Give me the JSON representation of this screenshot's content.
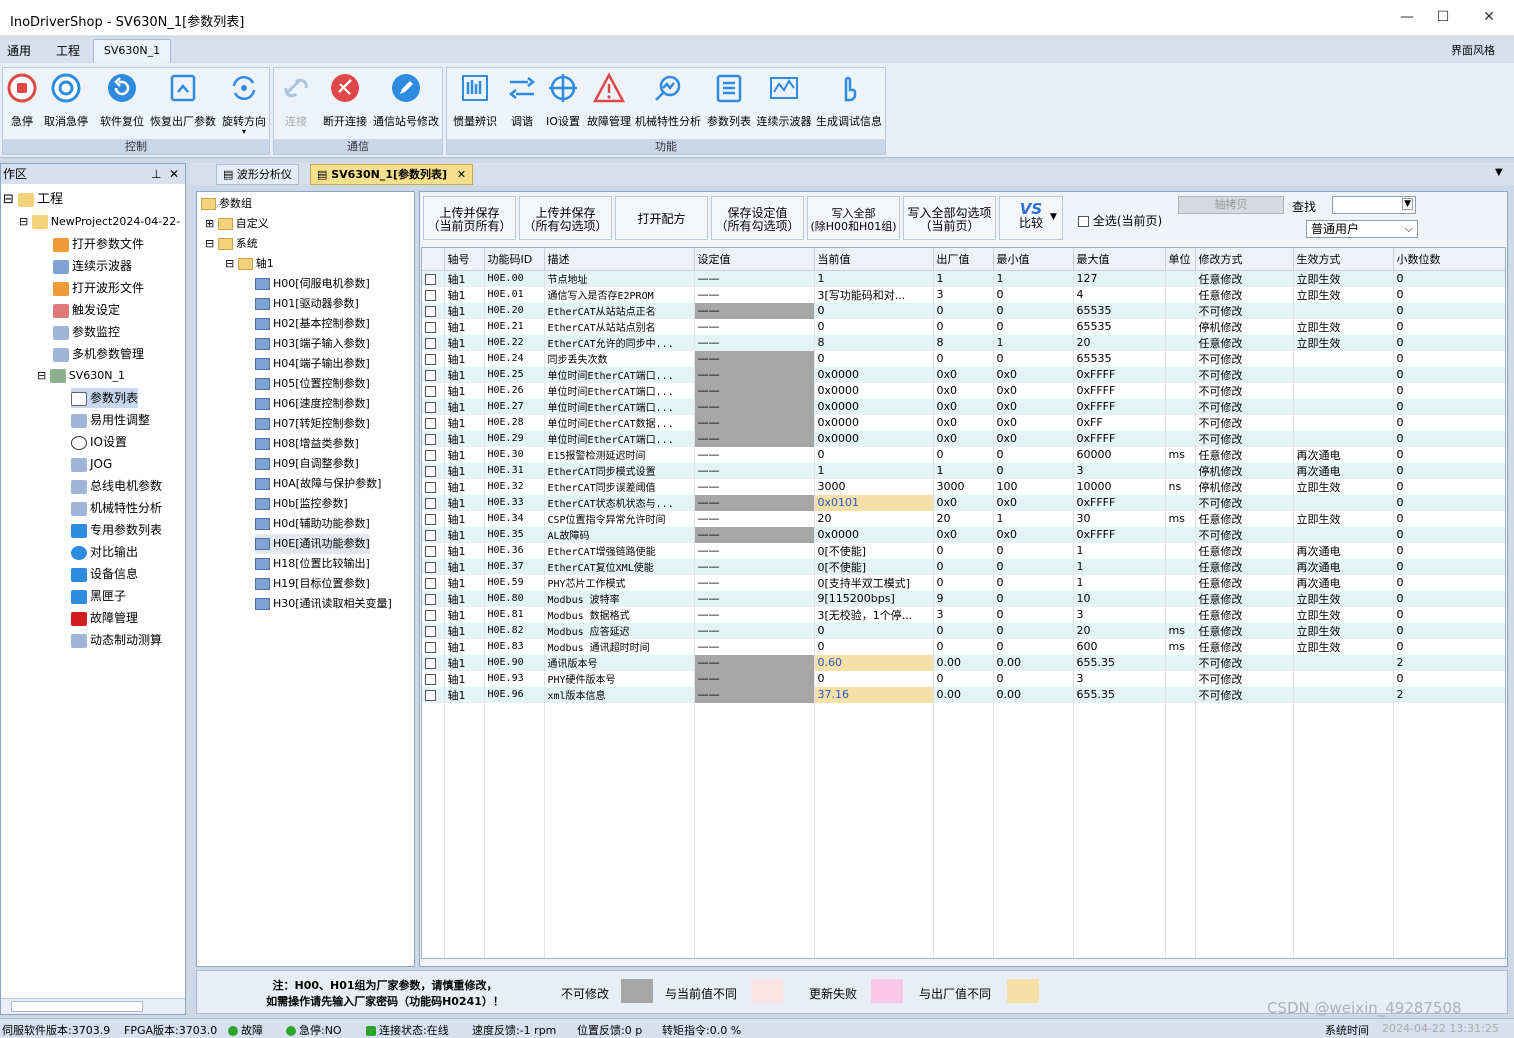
{
  "window": {
    "title": "InoDriverShop - SV630N_1[参数列表]",
    "minimize": "—",
    "maximize": "☐",
    "close": "✕"
  },
  "menu": {
    "items": [
      "通用",
      "工程"
    ],
    "active_tab": "SV630N_1",
    "right": "界面风格"
  },
  "ribbon": {
    "groups": [
      {
        "title": "控制"
      },
      {
        "title": "通信"
      },
      {
        "title": "功能"
      }
    ],
    "control": [
      "急停",
      "取消急停",
      "软件复位",
      "恢复出厂参数",
      "旋转方向"
    ],
    "comm": [
      "连接",
      "断开连接",
      "通信站号修改"
    ],
    "func": [
      "惯量辨识",
      "调谐",
      "IO设置",
      "故障管理",
      "机械特性分析",
      "参数列表",
      "连续示波器",
      "生成调试信息"
    ]
  },
  "left": {
    "header": "作区",
    "items": [
      "工程",
      "NewProject2024-04-22-",
      "打开参数文件",
      "连续示波器",
      "打开波形文件",
      "触发设定",
      "参数监控",
      "多机参数管理",
      "SV630N_1",
      "参数列表",
      "易用性调整",
      "IO设置",
      "JOG",
      "总线电机参数",
      "机械特性分析",
      "专用参数列表",
      "对比输出",
      "设备信息",
      "黑匣子",
      "故障管理",
      "动态制动测算"
    ]
  },
  "tabs": [
    "波形分析仪",
    "SV630N_1[参数列表]"
  ],
  "tree": {
    "root": "参数组",
    "custom": "自定义",
    "system": "系统",
    "axis": "轴1",
    "groups": [
      "H00[伺服电机参数]",
      "H01[驱动器参数]",
      "H02[基本控制参数]",
      "H03[端子输入参数]",
      "H04[端子输出参数]",
      "H05[位置控制参数]",
      "H06[速度控制参数]",
      "H07[转矩控制参数]",
      "H08[增益类参数]",
      "H09[自调整参数]",
      "H0A[故障与保护参数]",
      "H0b[监控参数]",
      "H0d[辅助功能参数]",
      "H0E[通讯功能参数]",
      "H18[位置比较输出]",
      "H19[目标位置参数]",
      "H30[通讯读取相关变量]"
    ]
  },
  "toolbar": {
    "b1a": "上传并保存",
    "b1b": "（当前页所有）",
    "b2a": "上传并保存",
    "b2b": "（所有勾选项）",
    "b3": "打开配方",
    "b4a": "保存设定值",
    "b4b": "（所有勾选项）",
    "b5a": "写入全部",
    "b5b": "(除H00和H01组)",
    "b6a": "写入全部勾选项",
    "b6b": "（当前页）",
    "vs": "VS",
    "compare": "比较",
    "selectall": "全选(当前页)",
    "copy": "轴拷贝",
    "search": "查找",
    "user": "普通用户"
  },
  "columns": [
    "",
    "轴号",
    "功能码ID",
    "描述",
    "设定值",
    "当前值",
    "出厂值",
    "最小值",
    "最大值",
    "单位",
    "修改方式",
    "生效方式",
    "小数位数"
  ],
  "rows": [
    [
      "轴1",
      "H0E.00",
      "节点地址",
      "——",
      "1",
      "1",
      "1",
      "127",
      "",
      "任意修改",
      "立即生效",
      "0",
      "",
      ""
    ],
    [
      "轴1",
      "H0E.01",
      "通信写入是否存E2PROM",
      "——",
      "3[写功能码和对...",
      "3",
      "0",
      "4",
      "",
      "任意修改",
      "立即生效",
      "0",
      "",
      ""
    ],
    [
      "轴1",
      "H0E.20",
      "EtherCAT从站站点正名",
      "——",
      "0",
      "0",
      "0",
      "65535",
      "",
      "不可修改",
      "",
      "0",
      "g",
      ""
    ],
    [
      "轴1",
      "H0E.21",
      "EtherCAT从站站点别名",
      "——",
      "0",
      "0",
      "0",
      "65535",
      "",
      "停机修改",
      "立即生效",
      "0",
      "",
      ""
    ],
    [
      "轴1",
      "H0E.22",
      "EtherCAT允许的同步中...",
      "——",
      "8",
      "8",
      "1",
      "20",
      "",
      "任意修改",
      "立即生效",
      "0",
      "",
      ""
    ],
    [
      "轴1",
      "H0E.24",
      "同步丢失次数",
      "——",
      "0",
      "0",
      "0",
      "65535",
      "",
      "不可修改",
      "",
      "0",
      "g",
      ""
    ],
    [
      "轴1",
      "H0E.25",
      "单位时间EtherCAT端口...",
      "——",
      "0x0000",
      "0x0",
      "0x0",
      "0xFFFF",
      "",
      "不可修改",
      "",
      "0",
      "g",
      ""
    ],
    [
      "轴1",
      "H0E.26",
      "单位时间EtherCAT端口...",
      "——",
      "0x0000",
      "0x0",
      "0x0",
      "0xFFFF",
      "",
      "不可修改",
      "",
      "0",
      "g",
      ""
    ],
    [
      "轴1",
      "H0E.27",
      "单位时间EtherCAT端口...",
      "——",
      "0x0000",
      "0x0",
      "0x0",
      "0xFFFF",
      "",
      "不可修改",
      "",
      "0",
      "g",
      ""
    ],
    [
      "轴1",
      "H0E.28",
      "单位时间EtherCAT数据...",
      "——",
      "0x0000",
      "0x0",
      "0x0",
      "0xFF",
      "",
      "不可修改",
      "",
      "0",
      "g",
      ""
    ],
    [
      "轴1",
      "H0E.29",
      "单位时间EtherCAT端口...",
      "——",
      "0x0000",
      "0x0",
      "0x0",
      "0xFFFF",
      "",
      "不可修改",
      "",
      "0",
      "g",
      ""
    ],
    [
      "轴1",
      "H0E.30",
      "E15报警检测延迟时间",
      "——",
      "0",
      "0",
      "0",
      "60000",
      "ms",
      "任意修改",
      "再次通电",
      "0",
      "",
      ""
    ],
    [
      "轴1",
      "H0E.31",
      "EtherCAT同步模式设置",
      "——",
      "1",
      "1",
      "0",
      "3",
      "",
      "停机修改",
      "再次通电",
      "0",
      "",
      ""
    ],
    [
      "轴1",
      "H0E.32",
      "EtherCAT同步误差阈值",
      "——",
      "3000",
      "3000",
      "100",
      "10000",
      "ns",
      "停机修改",
      "立即生效",
      "0",
      "",
      ""
    ],
    [
      "轴1",
      "H0E.33",
      "EtherCAT状态机状态与...",
      "——",
      "0x0101",
      "0x0",
      "0x0",
      "0xFFFF",
      "",
      "不可修改",
      "",
      "0",
      "g",
      "b"
    ],
    [
      "轴1",
      "H0E.34",
      "CSP位置指令异常允许时间",
      "——",
      "20",
      "20",
      "1",
      "30",
      "ms",
      "任意修改",
      "立即生效",
      "0",
      "",
      ""
    ],
    [
      "轴1",
      "H0E.35",
      "AL故障码",
      "——",
      "0x0000",
      "0x0",
      "0x0",
      "0xFFFF",
      "",
      "不可修改",
      "",
      "0",
      "g",
      ""
    ],
    [
      "轴1",
      "H0E.36",
      "EtherCAT增强链路使能",
      "——",
      "0[不使能]",
      "0",
      "0",
      "1",
      "",
      "任意修改",
      "再次通电",
      "0",
      "",
      ""
    ],
    [
      "轴1",
      "H0E.37",
      "EtherCAT复位XML使能",
      "——",
      "0[不使能]",
      "0",
      "0",
      "1",
      "",
      "任意修改",
      "再次通电",
      "0",
      "",
      ""
    ],
    [
      "轴1",
      "H0E.59",
      "PHY芯片工作模式",
      "——",
      "0[支持半双工模式]",
      "0",
      "0",
      "1",
      "",
      "任意修改",
      "再次通电",
      "0",
      "",
      ""
    ],
    [
      "轴1",
      "H0E.80",
      "Modbus 波特率",
      "——",
      "9[115200bps]",
      "9",
      "0",
      "10",
      "",
      "任意修改",
      "立即生效",
      "0",
      "",
      ""
    ],
    [
      "轴1",
      "H0E.81",
      "Modbus 数据格式",
      "——",
      "3[无校验，1个停...",
      "3",
      "0",
      "3",
      "",
      "任意修改",
      "立即生效",
      "0",
      "",
      ""
    ],
    [
      "轴1",
      "H0E.82",
      "Modbus 应答延迟",
      "——",
      "0",
      "0",
      "0",
      "20",
      "ms",
      "任意修改",
      "立即生效",
      "0",
      "",
      ""
    ],
    [
      "轴1",
      "H0E.83",
      "Modbus 通讯超时时间",
      "——",
      "0",
      "0",
      "0",
      "600",
      "ms",
      "任意修改",
      "立即生效",
      "0",
      "",
      ""
    ],
    [
      "轴1",
      "H0E.90",
      "通讯版本号",
      "——",
      "0.60",
      "0.00",
      "0.00",
      "655.35",
      "",
      "不可修改",
      "",
      "2",
      "g",
      "b"
    ],
    [
      "轴1",
      "H0E.93",
      "PHY硬件版本号",
      "——",
      "0",
      "0",
      "0",
      "3",
      "",
      "不可修改",
      "",
      "0",
      "g",
      ""
    ],
    [
      "轴1",
      "H0E.96",
      "xml版本信息",
      "——",
      "37.16",
      "0.00",
      "0.00",
      "655.35",
      "",
      "不可修改",
      "",
      "2",
      "g",
      "b"
    ]
  ],
  "legend": {
    "note1": "注：H00、H01组为厂家参数，请慎重修改，",
    "note2": "如需操作请先输入厂家密码（功能码H0241）！",
    "l1": "不可修改",
    "l2": "与当前值不同",
    "l3": "更新失败",
    "l4": "与出厂值不同",
    "c1": "#a6a6a6",
    "c2": "#fde4e4",
    "c3": "#fac8ec",
    "c4": "#f5e0a8"
  },
  "status": {
    "sw": "伺服软件版本:3703.9",
    "fpga": "FPGA版本:3703.0",
    "fault": "故障",
    "estop": "急停:NO",
    "conn": "连接状态:在线",
    "speed": "速度反馈:-1 rpm",
    "pos": "位置反馈:0 p",
    "torque": "转矩指令:0.0 %",
    "time_label": "系统时间",
    "time": "2024-04-22 13:31:25",
    "watermark": "CSDN @weixin_49287508"
  }
}
